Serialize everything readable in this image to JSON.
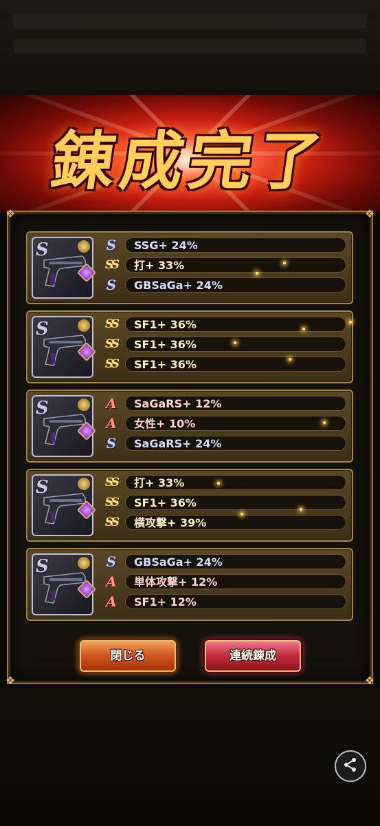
{
  "banner": {
    "title": "錬成完了"
  },
  "cards": [
    {
      "weapon_rank": "S",
      "abilities": [
        {
          "rank": "S",
          "text": "SSG+ 24%"
        },
        {
          "rank": "SS",
          "text": "打+ 33%"
        },
        {
          "rank": "S",
          "text": "GBSaGa+ 24%"
        }
      ]
    },
    {
      "weapon_rank": "S",
      "abilities": [
        {
          "rank": "SS",
          "text": "SF1+ 36%"
        },
        {
          "rank": "SS",
          "text": "SF1+ 36%"
        },
        {
          "rank": "SS",
          "text": "SF1+ 36%"
        }
      ]
    },
    {
      "weapon_rank": "S",
      "abilities": [
        {
          "rank": "A",
          "text": "SaGaRS+ 12%"
        },
        {
          "rank": "A",
          "text": "女性+ 10%"
        },
        {
          "rank": "S",
          "text": "SaGaRS+ 24%"
        }
      ]
    },
    {
      "weapon_rank": "S",
      "abilities": [
        {
          "rank": "SS",
          "text": "打+ 33%"
        },
        {
          "rank": "SS",
          "text": "SF1+ 36%"
        },
        {
          "rank": "SS",
          "text": "横攻撃+ 39%"
        }
      ]
    },
    {
      "weapon_rank": "S",
      "abilities": [
        {
          "rank": "S",
          "text": "GBSaGa+ 24%"
        },
        {
          "rank": "A",
          "text": "単体攻撃+ 12%"
        },
        {
          "rank": "A",
          "text": "SF1+ 12%"
        }
      ]
    }
  ],
  "buttons": {
    "close_label": "閉じる",
    "continue_label": "連続錬成"
  },
  "share": {
    "icon": "share-icon"
  },
  "colors": {
    "panel_border": "#9c7a3c",
    "close_button": "#d45a20",
    "continue_button": "#c8303e"
  }
}
